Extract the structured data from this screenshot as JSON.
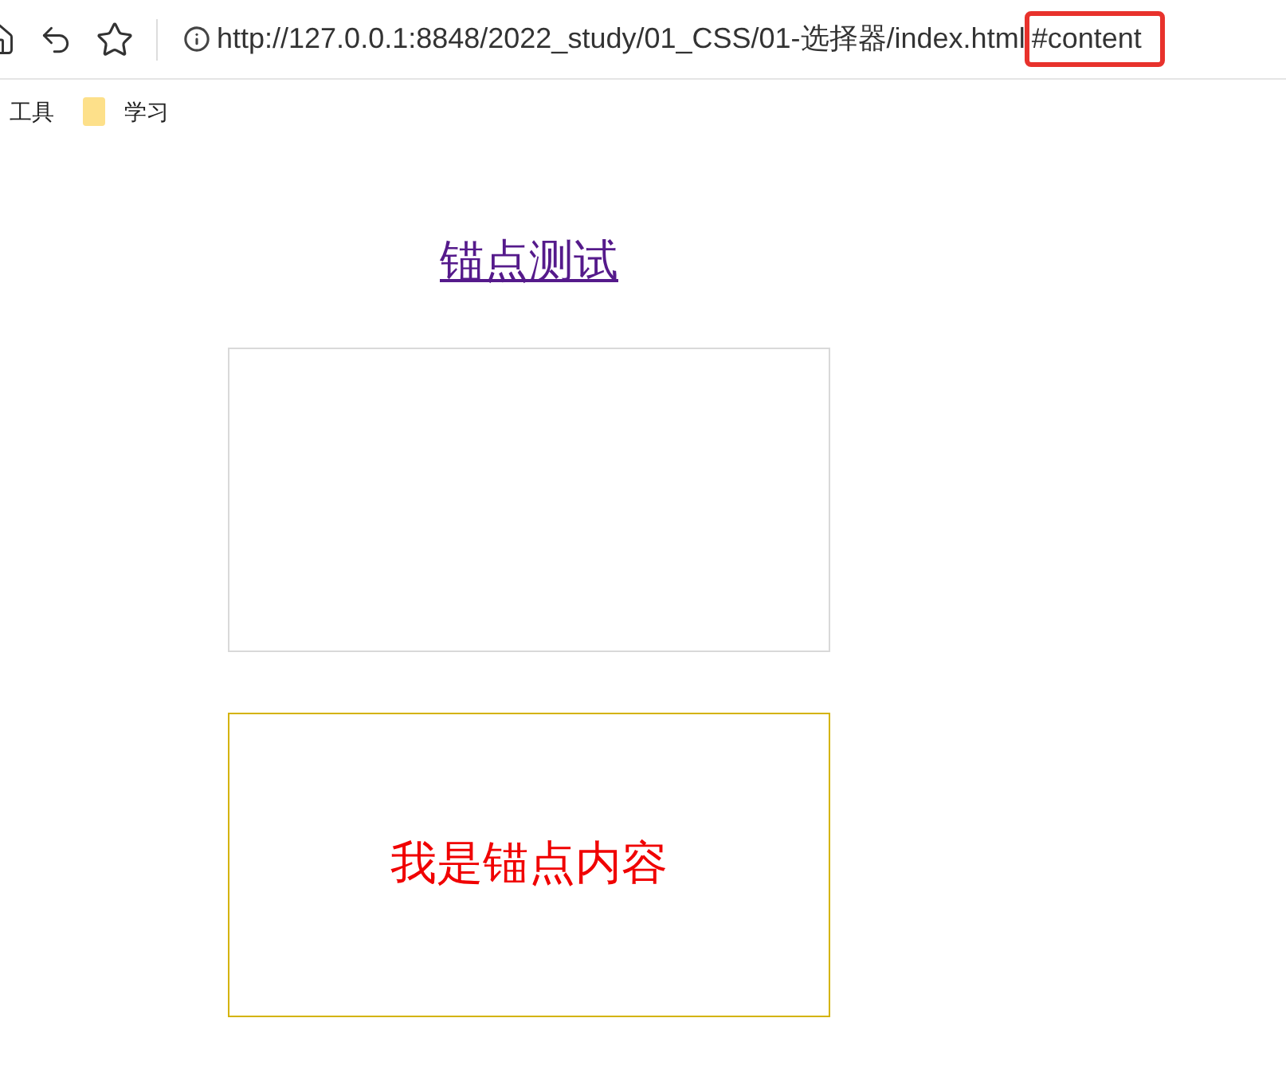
{
  "address_bar": {
    "url": "http://127.0.0.1:8848/2022_study/01_CSS/01-选择器/index.html",
    "hash": "#content",
    "hash_highlighted": true
  },
  "bookmarks": [
    {
      "label": "工具",
      "kind": "plain"
    },
    {
      "label": "学习",
      "kind": "folder"
    }
  ],
  "page": {
    "anchor_link": "锚点测试",
    "anchor_content": "我是锚点内容"
  }
}
